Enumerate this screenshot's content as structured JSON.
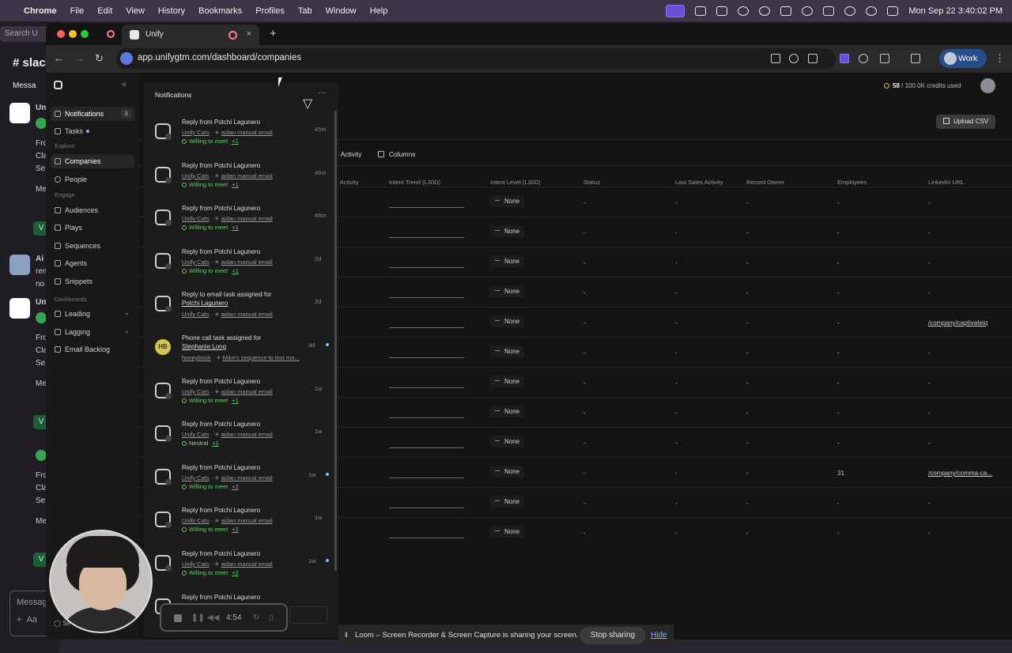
{
  "menubar": {
    "app": "Chrome",
    "items": [
      "File",
      "Edit",
      "View",
      "History",
      "Bookmarks",
      "Profiles",
      "Tab",
      "Window",
      "Help"
    ],
    "clock": "Mon Sep 22  3:40:02 PM"
  },
  "slack": {
    "search": "Search U",
    "channel": "# slack",
    "messages_tab": "Messa",
    "sender_un": "Un",
    "sender_ai": "Ai",
    "lines": [
      "Fro",
      "Cla",
      "Se",
      "Me",
      "rem",
      "no"
    ],
    "v_label": "V",
    "composer": "Messag",
    "plus": "+",
    "aa": "Aa"
  },
  "browser": {
    "tab_title": "Unify",
    "url": "app.unifygtm.com/dashboard/companies",
    "profile": "Work",
    "colors": {
      "profile": "#254e8d"
    }
  },
  "sidebar": {
    "items": [
      {
        "label": "Notifications",
        "badge": "3",
        "icon": "bell-icon"
      },
      {
        "label": "Tasks",
        "icon": "check-square-icon"
      }
    ],
    "explore_label": "Explore",
    "explore": [
      {
        "label": "Companies",
        "icon": "building-icon"
      },
      {
        "label": "People",
        "icon": "person-icon"
      }
    ],
    "engage_label": "Engage",
    "engage": [
      {
        "label": "Audiences",
        "icon": "filter-icon"
      },
      {
        "label": "Plays",
        "icon": "play-icon"
      },
      {
        "label": "Sequences",
        "icon": "send-icon"
      },
      {
        "label": "Agents",
        "icon": "sparkle-icon"
      },
      {
        "label": "Snippets",
        "icon": "scissors-icon"
      }
    ],
    "dashboards_label": "Dashboards",
    "dashboards": [
      {
        "label": "Leading",
        "icon": "trend-up-icon"
      },
      {
        "label": "Lagging",
        "icon": "trend-icon"
      },
      {
        "label": "Email Backlog",
        "icon": "chart-icon"
      }
    ],
    "user_row": "Se"
  },
  "main": {
    "credits_used": "58",
    "credits_total": " / 100.0K credits used",
    "upload_label": "Upload CSV",
    "toolbar": {
      "activity": "e Activity",
      "columns": "Columns"
    },
    "headers": [
      "b Activity",
      "Intent Trend (L30D)",
      "Intent Level (L30D)",
      "Status",
      "Last Sales Activity",
      "Record Owner",
      "Employees",
      "LinkedIn URL"
    ],
    "rows": [
      {
        "level": "None",
        "status": "-",
        "last_sales": "-",
        "owner": "-",
        "employees": "-",
        "linkedin": "-"
      },
      {
        "level": "None",
        "status": "-",
        "last_sales": "-",
        "owner": "-",
        "employees": "-",
        "linkedin": "-"
      },
      {
        "level": "None",
        "status": "-",
        "last_sales": "-",
        "owner": "-",
        "employees": "-",
        "linkedin": "-"
      },
      {
        "level": "None",
        "status": "-",
        "last_sales": "-",
        "owner": "-",
        "employees": "-",
        "linkedin": "-"
      },
      {
        "level": "None",
        "status": "-",
        "last_sales": "-",
        "owner": "-",
        "employees": "-",
        "linkedin": "/company/captivateiq"
      },
      {
        "level": "None",
        "status": "-",
        "last_sales": "-",
        "owner": "-",
        "employees": "-",
        "linkedin": "-"
      },
      {
        "level": "None",
        "status": "-",
        "last_sales": "-",
        "owner": "-",
        "employees": "-",
        "linkedin": "-"
      },
      {
        "level": "None",
        "status": "-",
        "last_sales": "-",
        "owner": "-",
        "employees": "-",
        "linkedin": "-"
      },
      {
        "level": "None",
        "status": "-",
        "last_sales": "-",
        "owner": "-",
        "employees": "-",
        "linkedin": "-"
      },
      {
        "level": "None",
        "status": "-",
        "last_sales": "-",
        "owner": "-",
        "employees": "31",
        "linkedin": "/company/comma-ca..."
      },
      {
        "level": "None",
        "status": "-",
        "last_sales": "-",
        "owner": "-",
        "employees": "-",
        "linkedin": "-"
      },
      {
        "level": "None",
        "status": "-",
        "last_sales": "-",
        "owner": "-",
        "employees": "-",
        "linkedin": "-"
      }
    ]
  },
  "notifications": {
    "title": "Notifications",
    "items": [
      {
        "line1": "Reply from Potchi Lagunero",
        "line2": "",
        "workspace": "Unify Cats",
        "sequence": "aidan manual email",
        "tag": "Willing to meet",
        "plus": "+1",
        "time": "45m",
        "unread": false
      },
      {
        "line1": "Reply from Potchi Lagunero",
        "line2": "",
        "workspace": "Unify Cats",
        "sequence": "aidan manual email",
        "tag": "Willing to meet",
        "plus": "+1",
        "time": "46m",
        "unread": false
      },
      {
        "line1": "Reply from Potchi Lagunero",
        "line2": "",
        "workspace": "Unify Cats",
        "sequence": "aidan manual email",
        "tag": "Willing to meet",
        "plus": "+1",
        "time": "49m",
        "unread": false
      },
      {
        "line1": "Reply from Potchi Lagunero",
        "line2": "",
        "workspace": "Unify Cats",
        "sequence": "aidan manual email",
        "tag": "Willing to meet",
        "plus": "+1",
        "time": "2d",
        "unread": false
      },
      {
        "line1": "Reply to email task assigned for",
        "line2": "Potchi Lagunero",
        "workspace": "Unify Cats",
        "sequence": "aidan manual email",
        "tag": "",
        "plus": "",
        "time": "2d",
        "unread": false
      },
      {
        "line1": "Phone call task assigned for",
        "line2": "Stephanie Long",
        "workspace": "honeybook",
        "sequence": "Mike's sequence to test ma...",
        "tag": "",
        "plus": "",
        "time": "3d",
        "unread": true,
        "avatar_text": "HB"
      },
      {
        "line1": "Reply from Potchi Lagunero",
        "line2": "",
        "workspace": "Unify Cats",
        "sequence": "aidan manual email",
        "tag": "Willing to meet",
        "plus": "+1",
        "time": "1w",
        "unread": false
      },
      {
        "line1": "Reply from Potchi Lagunero",
        "line2": "",
        "workspace": "Unify Cats",
        "sequence": "aidan manual email",
        "tag": "Neutral",
        "plus": "+1",
        "time": "1w",
        "unread": false
      },
      {
        "line1": "Reply from Potchi Lagunero",
        "line2": "",
        "workspace": "Unify Cats",
        "sequence": "aidan manual email",
        "tag": "Willing to meet",
        "plus": "+2",
        "time": "1w",
        "unread": true
      },
      {
        "line1": "Reply from Potchi Lagunero",
        "line2": "",
        "workspace": "Unify Cats",
        "sequence": "aidan manual email",
        "tag": "Willing to meet",
        "plus": "+2",
        "time": "1w",
        "unread": false
      },
      {
        "line1": "Reply from Potchi Lagunero",
        "line2": "",
        "workspace": "Unify Cats",
        "sequence": "aidan manual email",
        "tag": "Willing to meet",
        "plus": "+2",
        "time": "1w",
        "unread": true
      },
      {
        "line1": "Reply from Potchi Lagunero",
        "line2": "",
        "workspace": "",
        "sequence": "",
        "tag": "",
        "plus": "",
        "time": "",
        "unread": false
      }
    ]
  },
  "loom": {
    "timer": "4:54",
    "share_message": "Loom – Screen Recorder & Screen Capture is sharing your screen.",
    "stop_label": "Stop sharing",
    "hide_label": "Hide"
  }
}
